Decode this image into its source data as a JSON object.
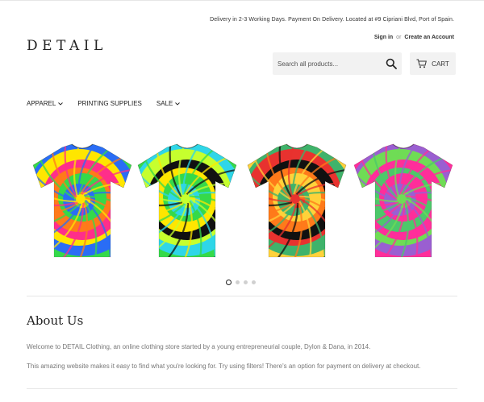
{
  "announcement": "Delivery in 2-3 Working Days. Payment On Delivery. Located at #9 Cipriani Blvd, Port of Spain.",
  "account": {
    "sign_in": "Sign in",
    "or": "or",
    "create": "Create an Account"
  },
  "logo": "DETAIL",
  "search": {
    "placeholder": "Search all products..."
  },
  "cart": {
    "label": "CART"
  },
  "nav": {
    "items": [
      {
        "label": "APPAREL",
        "has_dropdown": true
      },
      {
        "label": "PRINTING SUPPLIES",
        "has_dropdown": false
      },
      {
        "label": "SALE",
        "has_dropdown": true
      }
    ]
  },
  "slideshow": {
    "slides": [
      {
        "name": "rainbow-spiral-tie-dye-tshirt",
        "colors": [
          "#ff2e8a",
          "#ffe600",
          "#2a6df5",
          "#35d94a",
          "#ff7a1a"
        ]
      },
      {
        "name": "black-neon-spiral-tie-dye-tshirt",
        "colors": [
          "#111111",
          "#c6ff2e",
          "#2fd6e8",
          "#36d94a",
          "#ffe600"
        ]
      },
      {
        "name": "black-red-spiral-tie-dye-tshirt",
        "colors": [
          "#111111",
          "#e8322f",
          "#3fb36b",
          "#ffd23a",
          "#ff7a1a"
        ]
      },
      {
        "name": "pink-green-spiral-tie-dye-tshirt",
        "colors": [
          "#ff2e9a",
          "#6fdc55",
          "#9a5fd1",
          "#ff2e9a",
          "#4cc86a"
        ]
      }
    ],
    "active_index": 0,
    "dot_count": 4
  },
  "about": {
    "title": "About Us",
    "paragraph1": "Welcome to DETAIL Clothing, an online clothing store started by a young entrepreneurial couple, Dylon & Dana, in 2014.",
    "paragraph2": "This amazing website makes it easy to find what you're looking for. Try using filters! There's an option for payment on delivery at checkout."
  }
}
